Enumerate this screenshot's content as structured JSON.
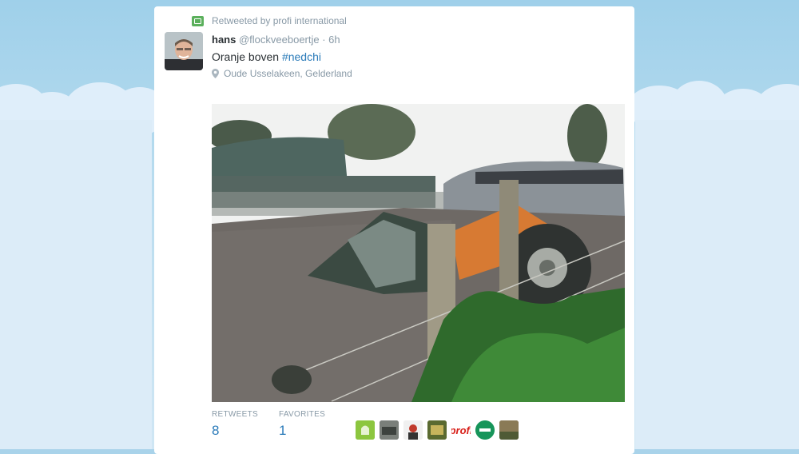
{
  "retweet": {
    "icon": "retweet-icon",
    "text": "Retweeted by profi international"
  },
  "tweet": {
    "name": "hans",
    "handle": "@flockveeboertje",
    "time": "· 6h",
    "text_prefix": "Oranje boven ",
    "hashtag": "#nedchi",
    "location": "Oude Usselakeen, Gelderland"
  },
  "stats": {
    "retweets_label": "RETWEETS",
    "retweets_value": "8",
    "favorites_label": "FAVORITES",
    "favorites_value": "1"
  },
  "profi_logo_text": "profi",
  "colors": {
    "link": "#2b7bb9",
    "muted": "#8899a6",
    "text": "#292f33",
    "retweet_green": "#5bb05c",
    "profi_red": "#d8201a"
  }
}
